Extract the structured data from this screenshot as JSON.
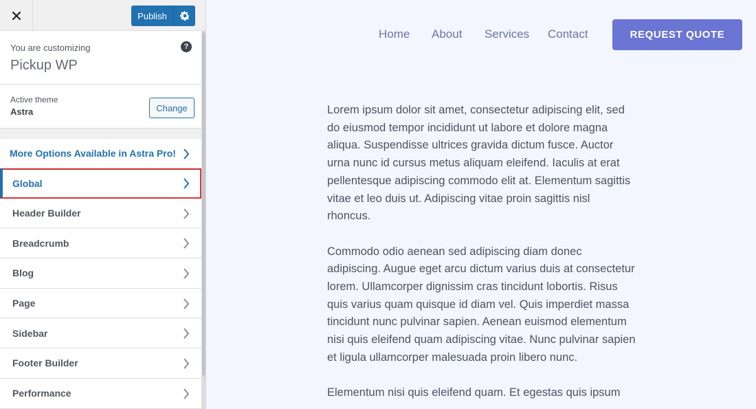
{
  "topbar": {
    "publish_label": "Publish"
  },
  "info": {
    "customizing_label": "You are customizing",
    "site_title": "Pickup WP",
    "help_glyph": "?"
  },
  "theme": {
    "label": "Active theme",
    "name": "Astra",
    "change_label": "Change"
  },
  "menu": {
    "pro_label": "More Options Available in Astra Pro!",
    "items": [
      {
        "label": "Global"
      },
      {
        "label": "Header Builder"
      },
      {
        "label": "Breadcrumb"
      },
      {
        "label": "Blog"
      },
      {
        "label": "Page"
      },
      {
        "label": "Sidebar"
      },
      {
        "label": "Footer Builder"
      },
      {
        "label": "Performance"
      }
    ]
  },
  "preview": {
    "nav": [
      "Home",
      "About",
      "Services",
      "Contact"
    ],
    "cta_label": "REQUEST QUOTE",
    "paragraphs": [
      "Lorem ipsum dolor sit amet, consectetur adipiscing elit, sed do eiusmod tempor incididunt ut labore et dolore magna aliqua. Suspendisse ultrices gravida dictum fusce. Auctor urna nunc id cursus metus aliquam eleifend. Iaculis at erat pellentesque adipiscing commodo elit at. Elementum sagittis vitae et leo duis ut. Adipiscing vitae proin sagittis nisl rhoncus.",
      "Commodo odio aenean sed adipiscing diam donec adipiscing. Augue eget arcu dictum varius duis at consectetur lorem. Ullamcorper dignissim cras tincidunt lobortis. Risus quis varius quam quisque id diam vel. Quis imperdiet massa tincidunt nunc pulvinar sapien. Aenean euismod elementum nisi quis eleifend quam adipiscing vitae. Nunc pulvinar sapien et ligula ullamcorper malesuada proin libero nunc.",
      "Elementum nisi quis eleifend quam. Et egestas quis ipsum"
    ]
  },
  "colors": {
    "accent": "#2271b1",
    "highlight_border": "#d63638",
    "cta": "#6a75d4",
    "preview_bg": "#f3f6fe"
  }
}
